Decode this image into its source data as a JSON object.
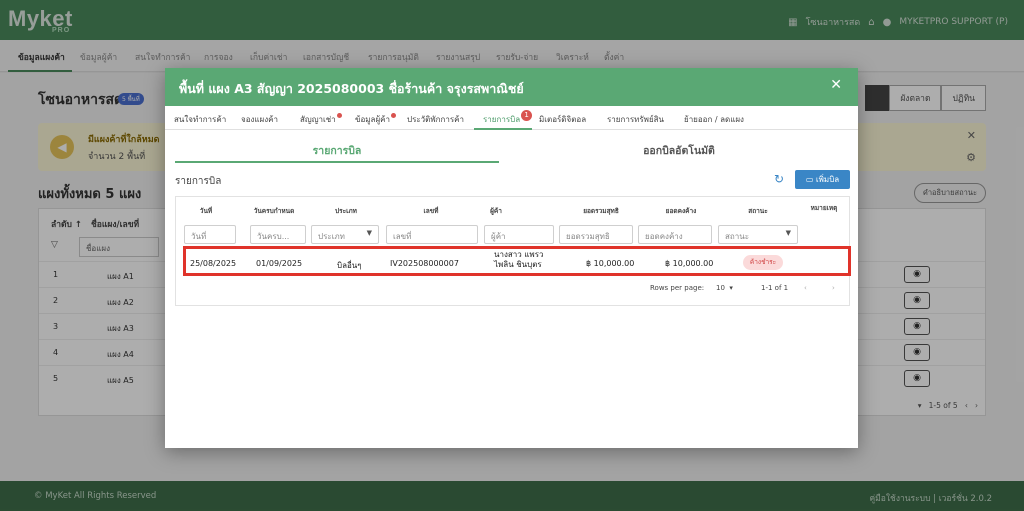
{
  "app": {
    "logo_text": "Myket",
    "logo_sub": "PRO",
    "market_name": "โซนอาหารสด",
    "user_label": "MYKETPRO SUPPORT (P)"
  },
  "main_nav": [
    "ข้อมูลแผงค้า",
    "ข้อมูลผู้ค้า",
    "สนใจทำการค้า",
    "การจอง",
    "เก็บค่าเช่า",
    "เอกสารบัญชี",
    "รายการอนุมัติ",
    "รายงานสรุป",
    "รายรับ-จ่าย",
    "วิเคราะห์",
    "ตั้งค่า"
  ],
  "page": {
    "title": "โซนอาหารสด",
    "badge": "5 พื้นที่",
    "view_tabs": [
      "ผังตลาด",
      "ปฏิทิน"
    ],
    "alert_line1": "มีแผงค้าที่ใกล้หมด",
    "alert_line2": "จำนวน 2 พื้นที่",
    "stalls_title": "แผงทั้งหมด 5 แผง",
    "legend_button": "คำอธิบายสถานะ",
    "table_headers": [
      "ลำดับ ↑",
      "ชื่อแผง/เลขที่"
    ],
    "filter_placeholder": "ชื่อแผง",
    "rows": [
      {
        "no": "1",
        "name": "แผง A1"
      },
      {
        "no": "2",
        "name": "แผง A2"
      },
      {
        "no": "3",
        "name": "แผง A3"
      },
      {
        "no": "4",
        "name": "แผง A4"
      },
      {
        "no": "5",
        "name": "แผง A5"
      }
    ],
    "pager_range": "1-5 of 5"
  },
  "modal": {
    "title": "พื้นที่ แผง A3 สัญญา 2025080003 ชื่อร้านค้า จรุงรสพาณิชย์",
    "close_icon": "close-icon",
    "tabs": [
      {
        "label": "สนใจทำการค้า"
      },
      {
        "label": "จองแผงค้า"
      },
      {
        "label": "สัญญาเช่า",
        "dot": true
      },
      {
        "label": "ข้อมูลผู้ค้า",
        "dot": true
      },
      {
        "label": "ประวัติพักการค้า"
      },
      {
        "label": "รายการบิล",
        "count": "1",
        "active": true
      },
      {
        "label": "มิเตอร์ดิจิตอล"
      },
      {
        "label": "รายการทรัพย์สิน"
      },
      {
        "label": "ย้ายออก / ลดแผง"
      }
    ],
    "sub_tabs": [
      "รายการบิล",
      "ออกบิลอัตโนมัติ"
    ],
    "list_title": "รายการบิล",
    "add_button": "เพิ่มบิล",
    "columns": [
      "วันที่",
      "วันครบกำหนด",
      "ประเภท",
      "เลขที่",
      "ผู้ค้า",
      "ยอดรวมสุทธิ",
      "ยอดคงค้าง",
      "สถานะ",
      "หมายเหตุ"
    ],
    "filters": [
      "วันที่",
      "วันครบ...",
      "ประเภท",
      "เลขที่",
      "ผู้ค้า",
      "ยอดรวมสุทธิ",
      "ยอดคงค้าง",
      "สถานะ"
    ],
    "bill_row": {
      "date": "25/08/2025",
      "due": "01/09/2025",
      "type": "บิลอื่นๆ",
      "number": "IV202508000007",
      "vendor_line1": "นางสาว แพรว",
      "vendor_line2": "ไพลิน ชินบุตร",
      "net_total": "฿ 10,000.00",
      "outstanding": "฿ 10,000.00",
      "status": "ค้างชำระ"
    },
    "pager": {
      "rows_label": "Rows per page:",
      "rows_value": "10",
      "range": "1-1 of 1"
    }
  },
  "footer": {
    "left": "© MyKet All Rights Reserved",
    "right": "คู่มือใช้งานระบบ | เวอร์ชั่น 2.0.2"
  },
  "colors": {
    "brand_green": "#4a8a5c",
    "modal_header": "#5aa874",
    "action_blue": "#3a86c6",
    "highlight_red": "#e0332a"
  }
}
